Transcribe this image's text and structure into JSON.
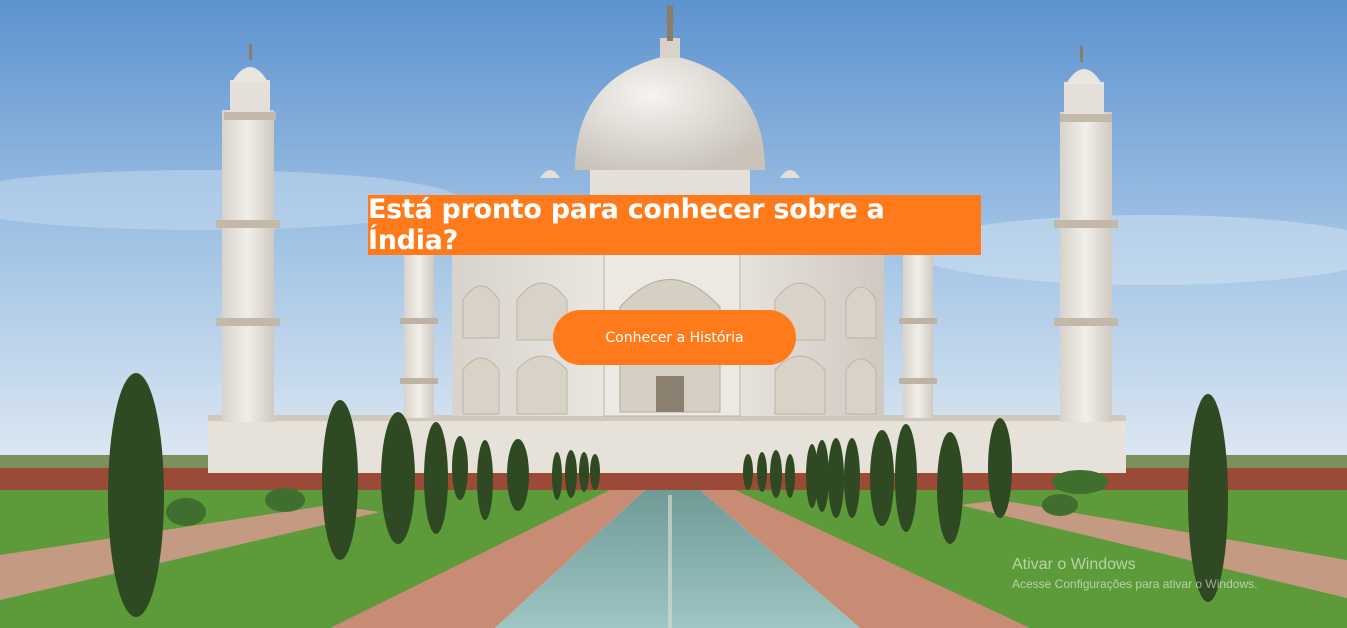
{
  "hero": {
    "headline": "Está pronto para conhecer sobre a Índia?",
    "cta_label": "Conhecer a História",
    "accent_color": "#ff7a1a",
    "background_image": "taj-mahal-photo"
  },
  "watermark": {
    "title": "Ativar o Windows",
    "subtitle": "Acesse Configurações para ativar o Windows."
  }
}
